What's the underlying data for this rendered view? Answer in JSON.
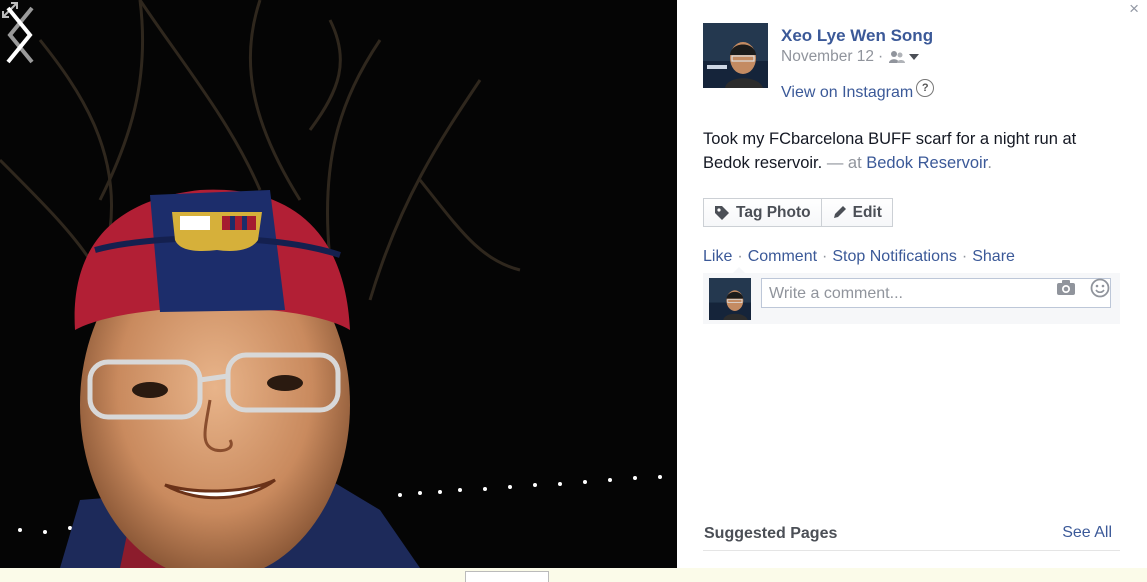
{
  "post": {
    "author": "Xeo Lye Wen Song",
    "date": "November 12",
    "separator": "·",
    "view_on_instagram": "View on Instagram",
    "help": "?",
    "caption_text": "Took my FCbarcelona BUFF scarf for a night run at Bedok reservoir.",
    "caption_at": " — at ",
    "place": "Bedok Reservoir",
    "caption_end": "."
  },
  "buttons": {
    "tag_photo": "Tag Photo",
    "edit": "Edit"
  },
  "actions": {
    "like": "Like",
    "comment": "Comment",
    "stop_notifications": "Stop Notifications",
    "share": "Share",
    "dot": "·"
  },
  "comment": {
    "placeholder": "Write a comment..."
  },
  "suggested": {
    "title": "Suggested Pages",
    "see_all": "See All"
  },
  "window": {
    "close": "×"
  },
  "icons": {
    "expand": "expand-icon",
    "prev": "chevron-left-icon",
    "next": "chevron-right-icon",
    "audience": "friends-icon",
    "tag": "tag-icon",
    "edit": "pencil-icon",
    "camera": "camera-icon",
    "emoji": "smile-icon"
  },
  "colors": {
    "link": "#3b5998",
    "meta": "#90949c",
    "text": "#141823",
    "photo_bg": "#000000"
  }
}
